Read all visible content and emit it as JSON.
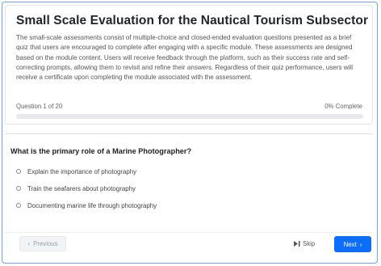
{
  "module": {
    "title": "Small Scale Evaluation for the Nautical Tourism Subsector",
    "description": "The small-scale assessments consist of multiple-choice and closed-ended evaluation questions presented as a brief quiz that users are encouraged to complete after engaging with a specific module. These assessments are designed based on the module content. Users will receive feedback through the platform, such as their success rate and self-correcting prompts, allowing them to revisit and refine their answers. Regardless of their quiz performance, users will receive a certificate upon completing the module associated with the assessment."
  },
  "progress": {
    "question_label": "Question 1 of 20",
    "complete_label": "0% Complete",
    "fraction": 0
  },
  "question": {
    "text": "What is the primary role of a Marine Photographer?",
    "options": [
      {
        "label": "Explain the importance of photography"
      },
      {
        "label": "Train the seafarers about photography"
      },
      {
        "label": "Documenting marine life through photography"
      }
    ]
  },
  "footer": {
    "previous_label": "Previous",
    "skip_label": "Skip",
    "next_label": "Next"
  },
  "colors": {
    "accent": "#0d6efd",
    "frame_border": "#6aa6e8"
  },
  "icons": {
    "previous": "chevron-left-icon",
    "skip": "skip-forward-icon",
    "next": "chevron-right-icon"
  }
}
